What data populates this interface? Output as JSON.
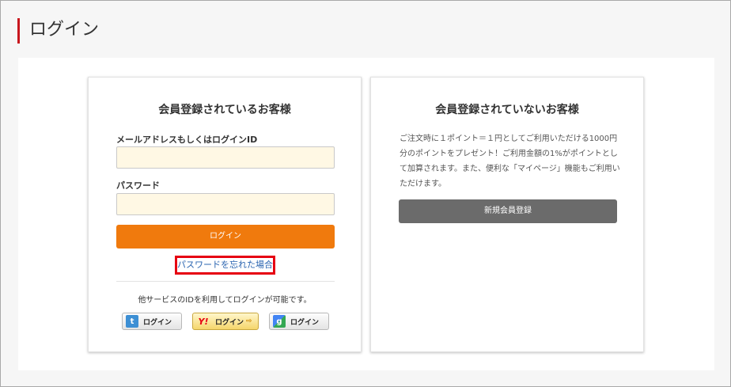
{
  "page": {
    "title": "ログイン"
  },
  "member": {
    "title": "会員登録されているお客様",
    "email_label": "メールアドレスもしくはログインID",
    "email_value": "",
    "password_label": "パスワード",
    "password_value": "",
    "login_button": "ログイン",
    "forgot_link": "パスワードを忘れた場合",
    "other_service_text": "他サービスのIDを利用してログインが可能です。",
    "social": {
      "twitter": {
        "label": "ログイン",
        "icon": "t"
      },
      "yahoo": {
        "label": "ログイン",
        "icon": "Y!",
        "arrow": "⇨"
      },
      "google": {
        "label": "ログイン",
        "icon": "g"
      }
    }
  },
  "guest": {
    "title": "会員登録されていないお客様",
    "description": "ご注文時に１ポイント＝１円としてご利用いただける1000円分のポイントをプレゼント！ご利用金額の1%がポイントとして加算されます。また、便利な「マイページ」機能もご利用いただけます。",
    "register_button": "新規会員登録"
  },
  "colors": {
    "accent_red": "#c8161d",
    "login_orange": "#f07a0d",
    "link_blue": "#2a64b0",
    "highlight_red": "#e60012",
    "register_gray": "#6b6b6b",
    "input_bg": "#fff8e4"
  }
}
